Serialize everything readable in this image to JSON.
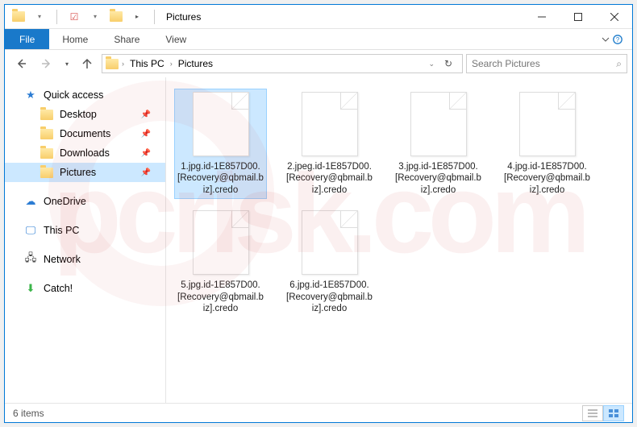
{
  "watermark": "pcrisk.com",
  "titlebar": {
    "title": "Pictures"
  },
  "ribbon": {
    "file": "File",
    "tabs": [
      "Home",
      "Share",
      "View"
    ]
  },
  "address": {
    "crumbs": [
      "This PC",
      "Pictures"
    ],
    "refresh_glyph": "↻"
  },
  "search": {
    "placeholder": "Search Pictures"
  },
  "sidebar": {
    "quick_access": "Quick access",
    "items": [
      {
        "label": "Desktop",
        "pinned": true
      },
      {
        "label": "Documents",
        "pinned": true
      },
      {
        "label": "Downloads",
        "pinned": true
      },
      {
        "label": "Pictures",
        "pinned": true,
        "selected": true
      }
    ],
    "onedrive": "OneDrive",
    "thispc": "This PC",
    "network": "Network",
    "catch": "Catch!"
  },
  "files": [
    {
      "name": "1.jpg.id-1E857D00.[Recovery@qbmail.biz].credo",
      "selected": true
    },
    {
      "name": "2.jpeg.id-1E857D00.[Recovery@qbmail.biz].credo"
    },
    {
      "name": "3.jpg.id-1E857D00.[Recovery@qbmail.biz].credo"
    },
    {
      "name": "4.jpg.id-1E857D00.[Recovery@qbmail.biz].credo"
    },
    {
      "name": "5.jpg.id-1E857D00.[Recovery@qbmail.biz].credo"
    },
    {
      "name": "6.jpg.id-1E857D00.[Recovery@qbmail.biz].credo"
    }
  ],
  "statusbar": {
    "count_label": "6 items"
  }
}
